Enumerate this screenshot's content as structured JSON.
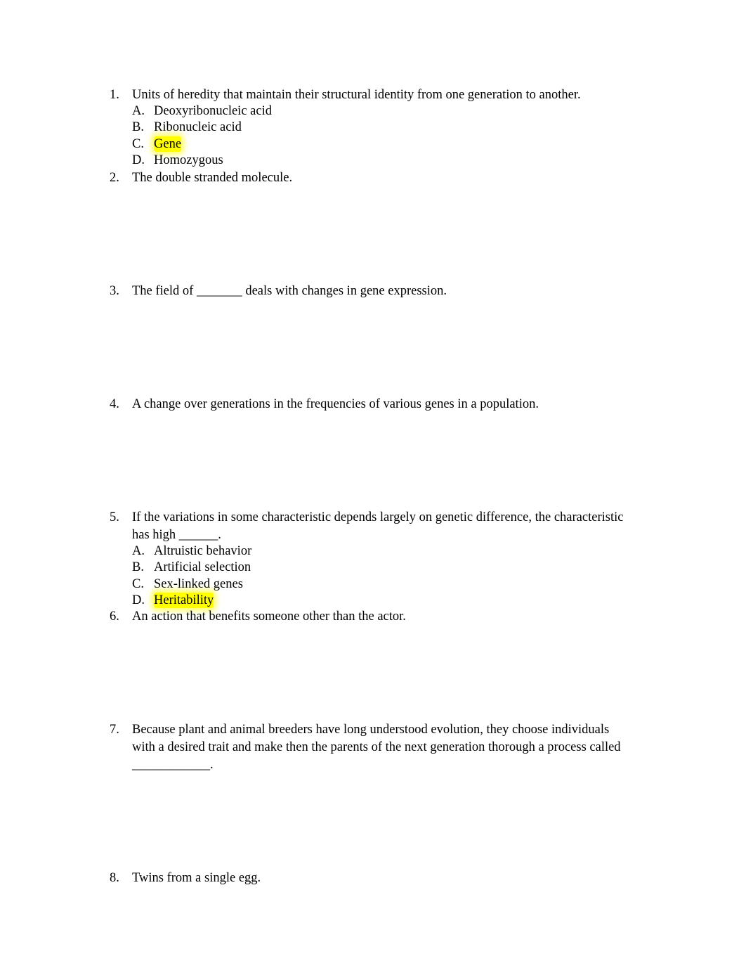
{
  "highlight_color": "#ffff00",
  "questions": [
    {
      "number": "1.",
      "lines": [
        "Units of heredity that maintain their structural identity from one generation to another."
      ],
      "options": [
        {
          "letter": "A.",
          "text": "Deoxyribonucleic acid",
          "highlighted": false
        },
        {
          "letter": "B.",
          "text": "Ribonucleic acid",
          "highlighted": false
        },
        {
          "letter": "C.",
          "text": "Gene",
          "highlighted": true
        },
        {
          "letter": "D.",
          "text": "Homozygous",
          "highlighted": false
        }
      ]
    },
    {
      "number": "2.",
      "lines": [
        "The double stranded molecule."
      ]
    },
    {
      "number": "3.",
      "lines": [
        "The field of _______ deals with changes in gene expression."
      ]
    },
    {
      "number": "4.",
      "lines": [
        "A change over generations in the frequencies of various genes in a population."
      ]
    },
    {
      "number": "5.",
      "lines": [
        "If the variations in some characteristic depends largely on genetic difference, the characteristic",
        "has high ______."
      ],
      "options": [
        {
          "letter": "A.",
          "text": "Altruistic behavior",
          "highlighted": false
        },
        {
          "letter": "B.",
          "text": "Artificial selection",
          "highlighted": false
        },
        {
          "letter": "C.",
          "text": "Sex-linked genes",
          "highlighted": false
        },
        {
          "letter": "D.",
          "text": "Heritability",
          "highlighted": true
        }
      ]
    },
    {
      "number": "6.",
      "lines": [
        "An action that benefits someone other than the actor."
      ]
    },
    {
      "number": "7.",
      "lines": [
        "Because plant and animal breeders have long understood evolution, they choose individuals",
        "with a desired trait and make then the parents of the next generation thorough a process called",
        "____________."
      ]
    },
    {
      "number": "8.",
      "lines": [
        "Twins from a single egg."
      ]
    }
  ]
}
